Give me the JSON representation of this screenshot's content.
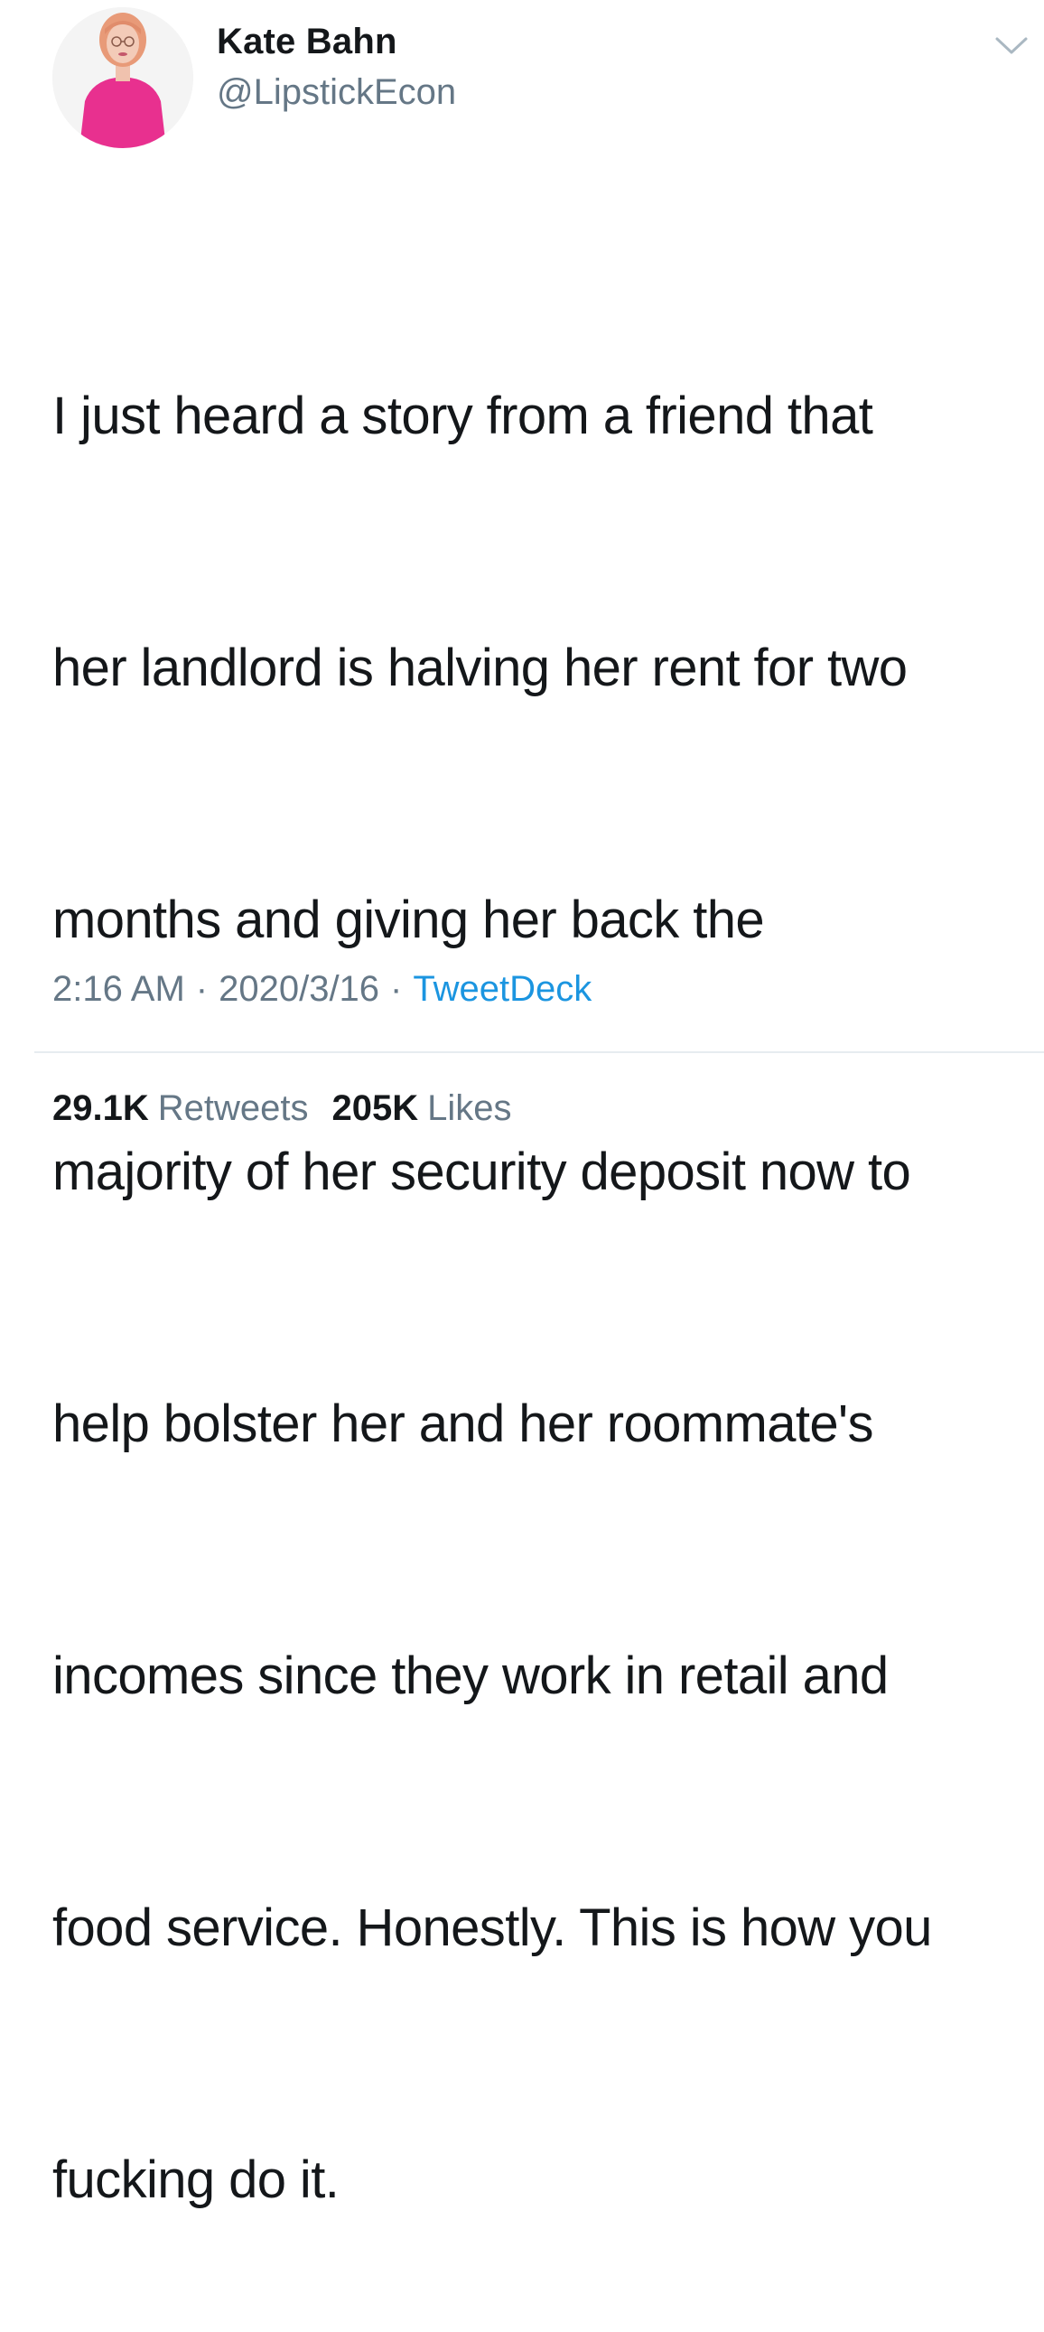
{
  "author": {
    "display_name": "Kate Bahn",
    "handle": "@LipstickEcon"
  },
  "tweet": {
    "lines": [
      "I just heard a story from a friend that",
      "her landlord is halving her rent for two",
      "months and giving her back the",
      "majority of her security deposit now to",
      "help bolster her and her roommate's",
      "incomes since they work in retail and",
      "food service. Honestly. This is how you",
      "fucking do it."
    ]
  },
  "meta": {
    "time": "2:16 AM",
    "separator": "·",
    "date": "2020/3/16",
    "source": "TweetDeck"
  },
  "stats": {
    "retweets_count": "29.1K",
    "retweets_label": "Retweets",
    "likes_count": "205K",
    "likes_label": "Likes"
  },
  "icons": {
    "more_menu": "chevron-down-icon"
  },
  "colors": {
    "text": "#14171a",
    "muted": "#657786",
    "link": "#1b95e0",
    "divider": "#e6ecf0"
  }
}
